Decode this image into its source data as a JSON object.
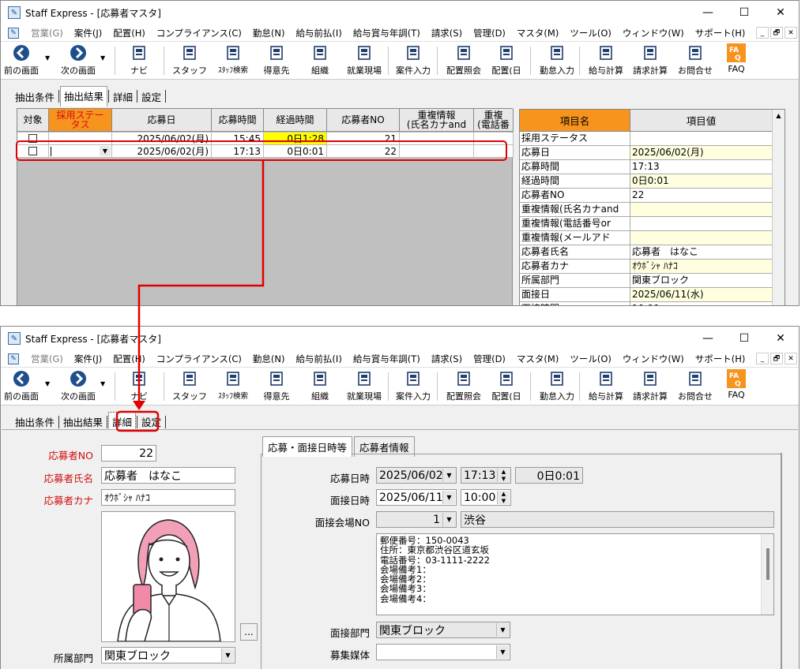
{
  "app": {
    "title": "Staff Express - [応募者マスタ]"
  },
  "window_controls": {
    "minimize": "—",
    "maximize": "☐",
    "close": "✕"
  },
  "menu": {
    "items": [
      "営業(G)",
      "案件(J)",
      "配置(H)",
      "コンプライアンス(C)",
      "勤怠(N)",
      "給与前払(I)",
      "給与賞与年調(T)",
      "請求(S)",
      "管理(D)",
      "マスタ(M)",
      "ツール(O)",
      "ウィンドウ(W)",
      "サポート(H)"
    ],
    "disabled_index": 0,
    "mdi_buttons": [
      "_",
      "🗗",
      "✕"
    ]
  },
  "toolbar": {
    "buttons": [
      {
        "label": "前の画面",
        "icon": "back-arrow-icon"
      },
      {
        "label": "次の画面",
        "icon": "forward-arrow-icon"
      },
      {
        "label": "ナビ",
        "icon": "keyboard-icon"
      },
      {
        "label": "スタッフ",
        "icon": "staff-icon"
      },
      {
        "label": "ｽﾀｯﾌ検索",
        "icon": "staff-search-icon"
      },
      {
        "label": "得意先",
        "icon": "client-icon"
      },
      {
        "label": "組織",
        "icon": "organization-icon"
      },
      {
        "label": "就業現場",
        "icon": "workplace-icon"
      },
      {
        "label": "案件入力",
        "icon": "job-entry-icon"
      },
      {
        "label": "配置照会",
        "icon": "placement-inquiry-icon"
      },
      {
        "label": "配置(日",
        "icon": "placement-day-icon"
      },
      {
        "label": "勤怠入力",
        "icon": "attendance-icon"
      },
      {
        "label": "給与計算",
        "icon": "payroll-icon"
      },
      {
        "label": "請求計算",
        "icon": "billing-icon"
      },
      {
        "label": "お問合せ",
        "icon": "inquiry-icon"
      },
      {
        "label": "FAQ",
        "icon": "faq-icon"
      }
    ]
  },
  "tabs": [
    "抽出条件",
    "抽出結果",
    "詳細",
    "設定"
  ],
  "grid": {
    "headers": [
      "対象",
      "採用ステータス",
      "応募日",
      "応募時間",
      "経過時間",
      "応募者NO",
      "重複情報(氏名カナand",
      "重複情報(電話番"
    ],
    "header_lines": [
      [
        "対象"
      ],
      [
        "採用ステー",
        "タス"
      ],
      [
        "応募日"
      ],
      [
        "応募時間"
      ],
      [
        "経過時間"
      ],
      [
        "応募者NO"
      ],
      [
        "重複情報",
        "(氏名カナand"
      ],
      [
        "重複",
        "(電話番"
      ]
    ],
    "rows": [
      {
        "status": "",
        "date": "2025/06/02(月)",
        "time": "15:45",
        "elapsed": "0日1:28",
        "no": "21"
      },
      {
        "status": "",
        "date": "2025/06/02(月)",
        "time": "17:13",
        "elapsed": "0日0:01",
        "no": "22"
      }
    ]
  },
  "property_grid": {
    "headers": {
      "name": "項目名",
      "value": "項目値"
    },
    "rows": [
      {
        "name": "採用ステータス",
        "value": ""
      },
      {
        "name": "応募日",
        "value": "2025/06/02(月)"
      },
      {
        "name": "応募時間",
        "value": "17:13"
      },
      {
        "name": "経過時間",
        "value": "0日0:01"
      },
      {
        "name": "応募者NO",
        "value": "22"
      },
      {
        "name": "重複情報(氏名カナand",
        "value": ""
      },
      {
        "name": "重複情報(電話番号or",
        "value": ""
      },
      {
        "name": "重複情報(メールアド",
        "value": ""
      },
      {
        "name": "応募者氏名",
        "value": "応募者　はなこ"
      },
      {
        "name": "応募者カナ",
        "value": "ｵｳﾎﾞｼｬ ﾊﾅｺ"
      },
      {
        "name": "所属部門",
        "value": "関東ブロック"
      },
      {
        "name": "面接日",
        "value": "2025/06/11(水)"
      },
      {
        "name": "面接時間",
        "value": "10:00"
      }
    ]
  },
  "detail": {
    "labels": {
      "applicant_no": "応募者NO",
      "name": "応募者氏名",
      "kana": "応募者カナ",
      "department": "所属部門"
    },
    "applicant_no": "22",
    "name": "応募者　はなこ",
    "kana": "ｵｳﾎﾞｼｬ ﾊﾅｺ",
    "department": "関東ブロック",
    "browse_button": "...",
    "subtabs": [
      "応募・面接日時等",
      "応募者情報"
    ],
    "fields": {
      "apply_datetime_label": "応募日時",
      "apply_date": "2025/06/02",
      "apply_time": "17:13",
      "elapsed": "0日0:01",
      "interview_datetime_label": "面接日時",
      "interview_date": "2025/06/11",
      "interview_time": "10:00",
      "venue_label": "面接会場NO",
      "venue_no": "1",
      "venue_name": "渋谷",
      "venue_memo": "郵便番号：150-0043\n住所：東京都渋谷区道玄坂\n電話番号：03-1111-2222\n会場備考1：\n会場備考2：\n会場備考3：\n会場備考4：",
      "interview_dept_label": "面接部門",
      "interview_dept": "関東ブロック",
      "media_label": "募集媒体",
      "media": ""
    }
  },
  "colors": {
    "highlight_orange": "#f7941d",
    "callout_red": "#e00000",
    "elapsed_yellow": "#ffff00",
    "alt_row": "#ffffe0"
  }
}
